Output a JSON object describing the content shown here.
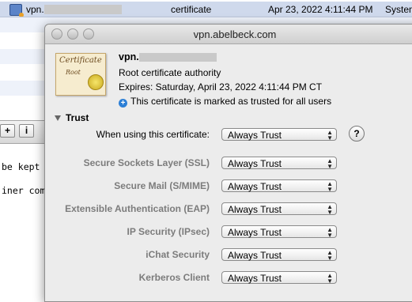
{
  "keychain_list": {
    "selected_row": {
      "name": "vpn.",
      "kind": "certificate",
      "date": "Apr 23, 2022 4:11:44 PM",
      "keychain": "System"
    }
  },
  "bottom_toolbar": {
    "add_label": "+",
    "info_label": "i"
  },
  "background_text": {
    "line1": "be kept",
    "line2": "iner comb"
  },
  "window": {
    "title": "vpn.abelbeck.com"
  },
  "certificate": {
    "name": "vpn.",
    "icon_title": "Certificate",
    "icon_subtitle": "Root",
    "role": "Root certificate authority",
    "expires": "Expires: Saturday, April 23, 2022 4:11:44 PM CT",
    "trusted_note": "This certificate is marked as trusted for all users"
  },
  "trust": {
    "section_label": "Trust",
    "help_label": "?",
    "rows": [
      {
        "label": "When using this certificate:",
        "value": "Always Trust"
      },
      {
        "label": "Secure Sockets Layer (SSL)",
        "value": "Always Trust"
      },
      {
        "label": "Secure Mail (S/MIME)",
        "value": "Always Trust"
      },
      {
        "label": "Extensible Authentication (EAP)",
        "value": "Always Trust"
      },
      {
        "label": "IP Security (IPsec)",
        "value": "Always Trust"
      },
      {
        "label": "iChat Security",
        "value": "Always Trust"
      },
      {
        "label": "Kerberos Client",
        "value": "Always Trust"
      }
    ]
  }
}
